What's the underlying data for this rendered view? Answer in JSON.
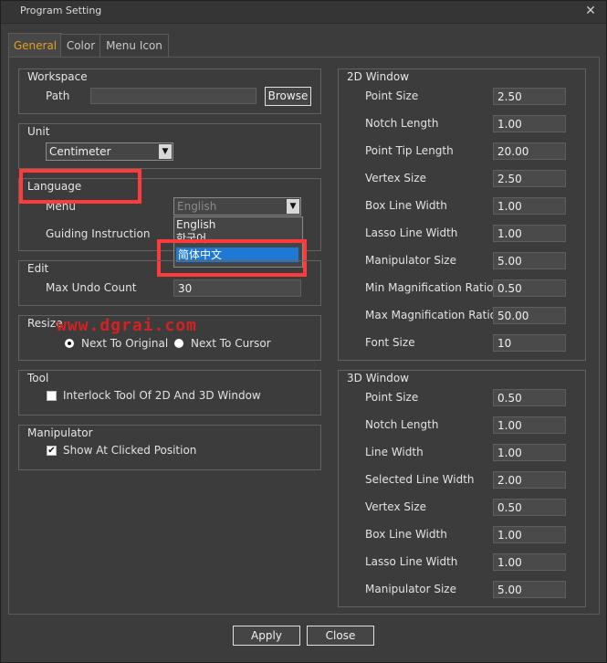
{
  "window": {
    "title": "Program Setting",
    "close_glyph": "✕"
  },
  "tabs": [
    {
      "label": "General",
      "active": true
    },
    {
      "label": "Color",
      "active": false
    },
    {
      "label": "Menu Icon",
      "active": false
    }
  ],
  "workspace": {
    "title": "Workspace",
    "path_label": "Path",
    "path_value": "",
    "browse_label": "Browse"
  },
  "unit": {
    "title": "Unit",
    "selected": "Centimeter"
  },
  "language": {
    "title": "Language",
    "menu_label": "Menu",
    "guiding_label": "Guiding Instruction",
    "menu_selected": "English",
    "dropdown_options": [
      "English",
      "한국어",
      "简体中文"
    ],
    "highlighted_option": "简体中文"
  },
  "edit": {
    "title": "Edit",
    "max_undo_label": "Max Undo Count",
    "max_undo_value": "30"
  },
  "resize": {
    "title": "Resize",
    "option1": "Next To Original",
    "option2": "Next To Cursor",
    "selected": "Next To Original"
  },
  "tool": {
    "title": "Tool",
    "interlock_label": "Interlock Tool Of 2D And 3D Window",
    "checked": false
  },
  "manipulator": {
    "title": "Manipulator",
    "show_label": "Show At Clicked Position",
    "checked": true
  },
  "window2d": {
    "title": "2D Window",
    "rows": [
      {
        "label": "Point Size",
        "value": "2.50"
      },
      {
        "label": "Notch Length",
        "value": "1.00"
      },
      {
        "label": "Point Tip Length",
        "value": "20.00"
      },
      {
        "label": "Vertex Size",
        "value": "2.50"
      },
      {
        "label": "Box Line Width",
        "value": "1.00"
      },
      {
        "label": "Lasso Line Width",
        "value": "1.00"
      },
      {
        "label": "Manipulator Size",
        "value": "5.00"
      },
      {
        "label": "Min Magnification Ratio",
        "value": "0.50"
      },
      {
        "label": "Max Magnification Ratio",
        "value": "50.00"
      },
      {
        "label": "Font Size",
        "value": "10"
      }
    ]
  },
  "window3d": {
    "title": "3D Window",
    "rows": [
      {
        "label": "Point Size",
        "value": "0.50"
      },
      {
        "label": "Notch Length",
        "value": "1.00"
      },
      {
        "label": "Line Width",
        "value": "1.00"
      },
      {
        "label": "Selected Line Width",
        "value": "2.00"
      },
      {
        "label": "Vertex Size",
        "value": "0.50"
      },
      {
        "label": "Box Line Width",
        "value": "1.00"
      },
      {
        "label": "Lasso Line Width",
        "value": "1.00"
      },
      {
        "label": "Manipulator Size",
        "value": "5.00"
      }
    ]
  },
  "footer": {
    "apply_label": "Apply",
    "close_label": "Close"
  },
  "watermark": {
    "text": "www.dgrai.com"
  },
  "colors": {
    "accent_tab": "#e0a020",
    "highlight_annotation": "#ff3b3b",
    "selection": "#1e78d6"
  }
}
